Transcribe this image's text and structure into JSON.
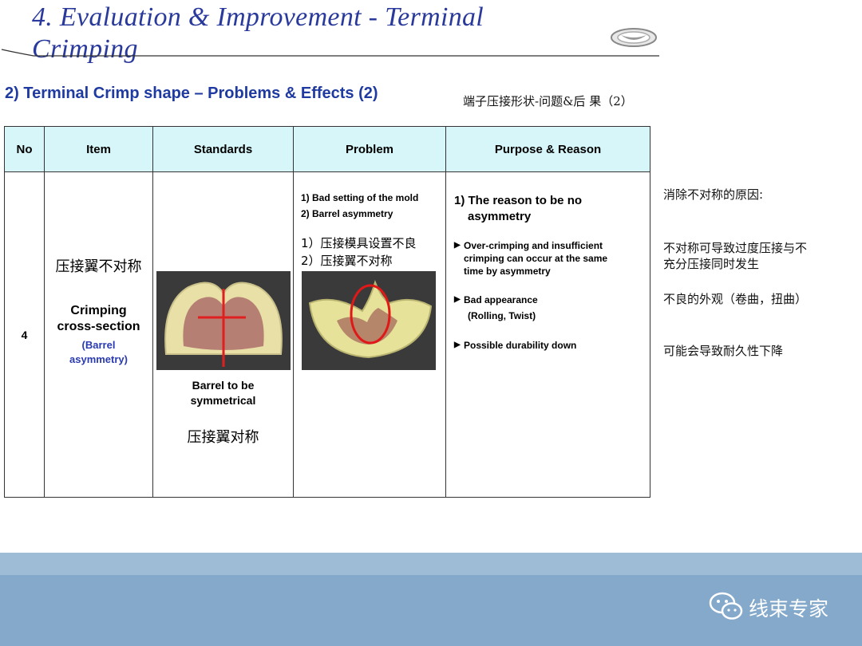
{
  "header": {
    "title_line1": "4. Evaluation & Improvement - Terminal",
    "title_line2": "Crimping",
    "subtitle": "2) Terminal Crimp shape – Problems & Effects (2)",
    "subtitle_cn": "端子压接形状-问题&后 果（2）"
  },
  "table": {
    "headers": [
      "No",
      "Item",
      "Standards",
      "Problem",
      "Purpose & Reason"
    ],
    "row": {
      "no": "4",
      "item_cn": "压接翼不对称",
      "item_en": [
        "Crimping",
        "cross-section"
      ],
      "item_en2": [
        "(Barrel",
        "asymmetry)"
      ],
      "standards_en": [
        "Barrel to be",
        "symmetrical"
      ],
      "standards_cn": "压接翼对称",
      "problem_en": [
        "1) Bad setting of the mold",
        "2) Barrel asymmetry"
      ],
      "problem_cn": [
        "1）压接模具设置不良",
        "2）压接翼不对称"
      ],
      "purpose_head": [
        "1) The reason to be no",
        "asymmetry"
      ],
      "purpose_b1": [
        "Over-crimping and insufficient",
        "crimping can occur at the same",
        "time by asymmetry"
      ],
      "purpose_b2": [
        "Bad appearance",
        "(Rolling, Twist)"
      ],
      "purpose_b3": "Possible durability down"
    }
  },
  "side_notes": {
    "n1": "消除不对称的原因:",
    "n2a": "不对称可导致过度压接与不",
    "n2b": "充分压接同时发生",
    "n3": "不良的外观（卷曲，扭曲）",
    "n4": "可能会导致耐久性下降"
  },
  "footer": {
    "brand": "线束专家"
  },
  "colors": {
    "title": "#2a3a9c",
    "header_bg": "#d6f6fa",
    "footer_band": "#84a9ca",
    "highlight": "#e01818"
  },
  "icons": {
    "logo": "car-brand-logo-icon",
    "wechat": "wechat-icon"
  }
}
